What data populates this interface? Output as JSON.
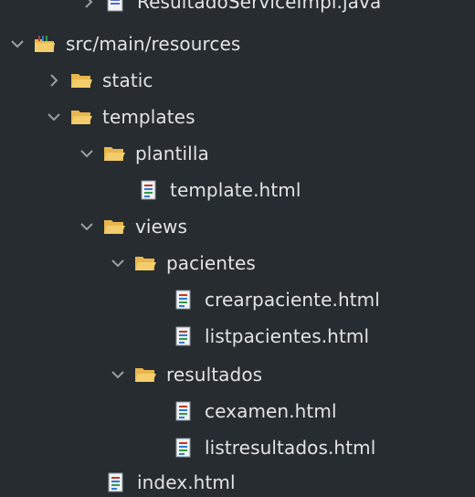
{
  "tree": {
    "items": [
      {
        "label": "ResultadoServiceImpl.java",
        "icon": "java-file-icon",
        "expanded": false
      },
      {
        "label": "src/main/resources",
        "icon": "source-folder-icon",
        "expanded": true
      },
      {
        "label": "static",
        "icon": "folder-icon",
        "expanded": false
      },
      {
        "label": "templates",
        "icon": "folder-open-icon",
        "expanded": true
      },
      {
        "label": "plantilla",
        "icon": "folder-open-icon",
        "expanded": true
      },
      {
        "label": "template.html",
        "icon": "html-file-icon"
      },
      {
        "label": "views",
        "icon": "folder-open-icon",
        "expanded": true
      },
      {
        "label": "pacientes",
        "icon": "folder-open-icon",
        "expanded": true
      },
      {
        "label": "crearpaciente.html",
        "icon": "html-file-icon"
      },
      {
        "label": "listpacientes.html",
        "icon": "html-file-icon"
      },
      {
        "label": "resultados",
        "icon": "folder-open-icon",
        "expanded": true
      },
      {
        "label": "cexamen.html",
        "icon": "html-file-icon"
      },
      {
        "label": "listresultados.html",
        "icon": "html-file-icon"
      },
      {
        "label": "index.html",
        "icon": "html-file-icon"
      }
    ]
  },
  "colors": {
    "background": "#262c30",
    "folder": "#e8b64c",
    "text": "#e3e3e3",
    "chevron": "#9aa0a6"
  }
}
